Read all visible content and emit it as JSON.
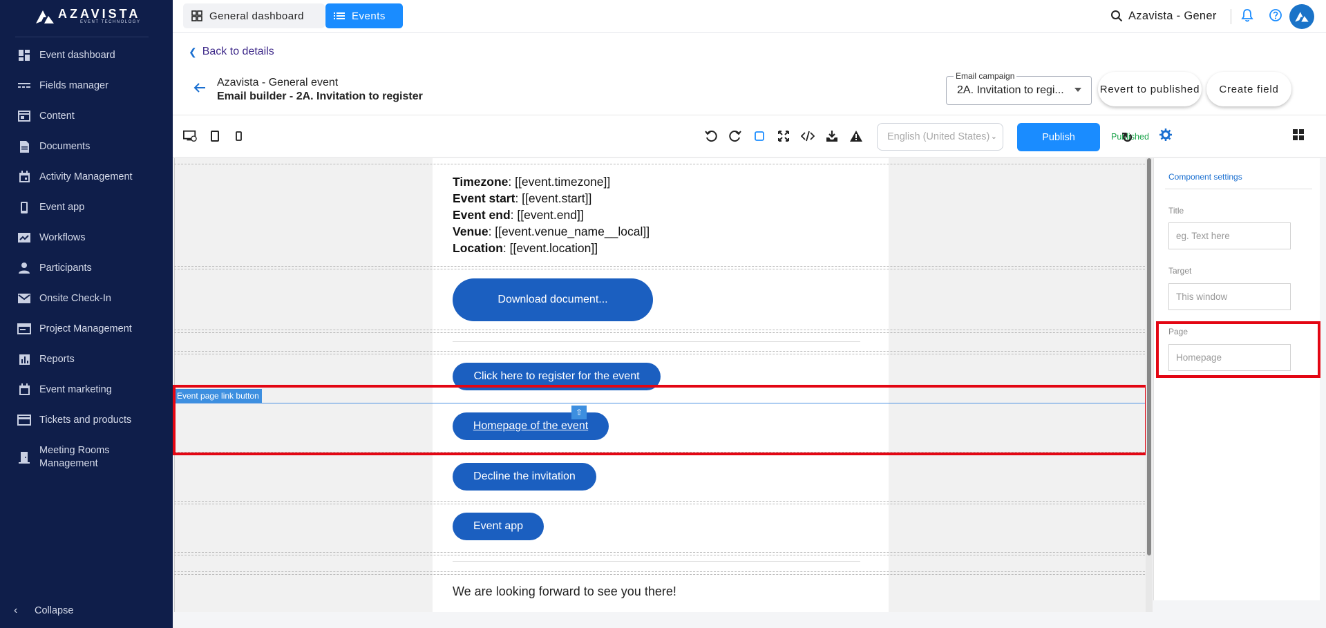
{
  "brand": {
    "name": "AZAVISTA",
    "tagline": "EVENT TECHNOLOGY"
  },
  "sidebar": {
    "items": [
      {
        "label": "Event dashboard",
        "icon": "dashboard-icon"
      },
      {
        "label": "Fields manager",
        "icon": "fields-icon"
      },
      {
        "label": "Content",
        "icon": "content-icon"
      },
      {
        "label": "Documents",
        "icon": "document-icon"
      },
      {
        "label": "Activity Management",
        "icon": "calendar-icon"
      },
      {
        "label": "Event app",
        "icon": "phone-icon"
      },
      {
        "label": "Workflows",
        "icon": "workflow-icon"
      },
      {
        "label": "Participants",
        "icon": "person-icon"
      },
      {
        "label": "Onsite Check-In",
        "icon": "mail-icon"
      },
      {
        "label": "Project Management",
        "icon": "project-icon"
      },
      {
        "label": "Reports",
        "icon": "reports-icon"
      },
      {
        "label": "Event marketing",
        "icon": "calendar-icon"
      },
      {
        "label": "Tickets and products",
        "icon": "ticket-icon"
      },
      {
        "label": "Meeting Rooms Management",
        "icon": "door-icon"
      }
    ],
    "collapse_label": "Collapse"
  },
  "topbar": {
    "tab_general": "General dashboard",
    "tab_events": "Events",
    "search_text": "Azavista - Gener"
  },
  "header": {
    "back_label": "Back to details",
    "event_name": "Azavista - General event",
    "builder_title": "Email builder - 2A. Invitation to register",
    "campaign_label": "Email campaign",
    "campaign_value": "2A. Invitation to regi...",
    "revert_label": "Revert to published",
    "create_field_label": "Create field"
  },
  "toolbar": {
    "language": "English (United States)",
    "publish_label": "Publish",
    "status_label": "Published"
  },
  "email": {
    "info": [
      {
        "key": "Timezone",
        "value": ": [[event.timezone]]"
      },
      {
        "key": "Event start",
        "value": ": [[event.start]]"
      },
      {
        "key": "Event end",
        "value": ": [[event.end]]"
      },
      {
        "key": "Venue",
        "value": ": [[event.venue_name__local]]"
      },
      {
        "key": "Location",
        "value": ": [[event.location]]"
      }
    ],
    "buttons": {
      "download": "Download document...",
      "register": "Click here to register for the event",
      "homepage": "Homepage of the event",
      "decline": "Decline the invitation",
      "event_app": "Event app"
    },
    "closing": "We are looking forward to see you there!",
    "selected_component_label": "Event page link button"
  },
  "settings_panel": {
    "title": "Component settings",
    "fields": [
      {
        "label": "Title",
        "placeholder": "eg. Text here"
      },
      {
        "label": "Target",
        "placeholder": "This window"
      },
      {
        "label": "Page",
        "placeholder": "Homepage"
      }
    ]
  },
  "colors": {
    "sidebar_bg": "#0f1e4a",
    "primary": "#1a8cff",
    "email_button": "#1b5fc0",
    "highlight": "#e30613",
    "published": "#1aa34a"
  }
}
